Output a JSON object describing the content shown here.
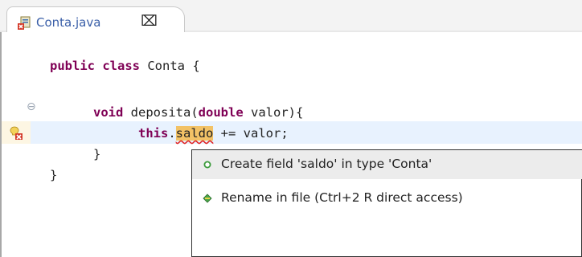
{
  "tab": {
    "file_name": "Conta.java",
    "close_symbol": "⌧"
  },
  "code": {
    "line1": {
      "kw1": "public",
      "kw2": "class",
      "rest": " Conta {"
    },
    "line3": {
      "kw1": "void",
      "mid": " deposita(",
      "kw2": "double",
      "rest": " valor){"
    },
    "line4": {
      "kw1": "this",
      "dot": ".",
      "field": "saldo",
      "rest": " += valor;"
    },
    "line5": {
      "text": "}"
    },
    "line6": {
      "text": "}"
    }
  },
  "gutter": {
    "fold_symbol": "⊖"
  },
  "quickfix": {
    "items": [
      {
        "label": "Create field 'saldo' in type 'Conta'",
        "icon": "field-icon"
      },
      {
        "label": "Rename in file (Ctrl+2 R direct access)",
        "icon": "rename-icon"
      }
    ]
  },
  "colors": {
    "keyword": "#7f0055",
    "current_line": "#e8f2fe",
    "occurrence_highlight": "#f2c266",
    "error_underline": "#e02020",
    "tab_label": "#3a5fa8"
  }
}
